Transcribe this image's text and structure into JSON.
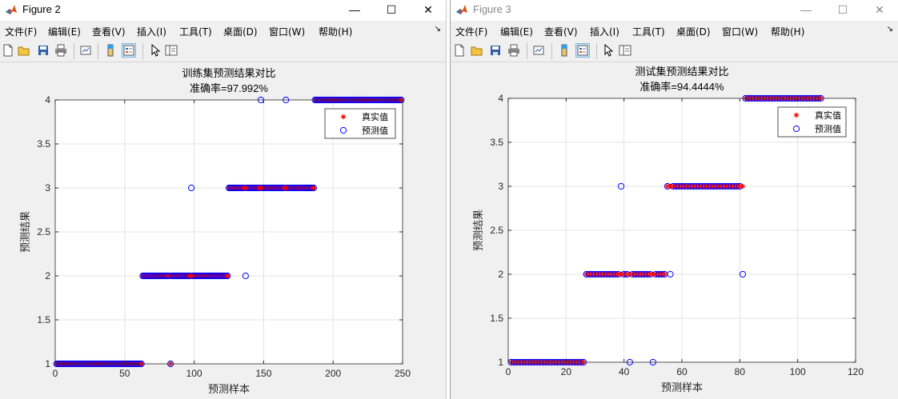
{
  "windows": [
    {
      "title": "Figure 2",
      "menus": [
        "文件(F)",
        "编辑(E)",
        "查看(V)",
        "插入(I)",
        "工具(T)",
        "桌面(D)",
        "窗口(W)",
        "帮助(H)"
      ],
      "controls": {
        "minimize": "—",
        "maximize": "☐",
        "close": "✕"
      }
    },
    {
      "title": "Figure 3",
      "menus": [
        "文件(F)",
        "编辑(E)",
        "查看(V)",
        "插入(I)",
        "工具(T)",
        "桌面(D)",
        "窗口(W)",
        "帮助(H)"
      ],
      "controls": {
        "minimize": "—",
        "maximize": "☐",
        "close": "✕"
      }
    }
  ],
  "toolbar_icons": [
    "new-figure-icon",
    "open-file-icon",
    "save-icon",
    "print-icon",
    "link-plot-icon",
    "colorbar-icon",
    "legend-icon",
    "pointer-icon",
    "plot-browser-icon"
  ],
  "chart_data": [
    {
      "type": "scatter",
      "title": "训练集预测结果对比",
      "subtitle": "准确率=97.992%",
      "xlabel": "预测样本",
      "ylabel": "预测结果",
      "xlim": [
        0,
        250
      ],
      "ylim": [
        1,
        4
      ],
      "xticks": [
        0,
        50,
        100,
        150,
        200,
        250
      ],
      "yticks": [
        1,
        1.5,
        2,
        2.5,
        3,
        3.5,
        4
      ],
      "xtick_labels": [
        "0",
        "50",
        "100",
        "150",
        "200",
        "250"
      ],
      "ytick_labels": [
        "1",
        "1.5",
        "2",
        "2.5",
        "3",
        "3.5",
        "4"
      ],
      "grid": true,
      "legend": {
        "position": "top-right",
        "entries": [
          "真实值",
          "预测值"
        ]
      },
      "colors": {
        "true": "#ff0000",
        "pred": "#0000ff"
      },
      "segments": [
        {
          "class": 1,
          "from": 1,
          "to": 62
        },
        {
          "class": 2,
          "from": 63,
          "to": 124
        },
        {
          "class": 3,
          "from": 125,
          "to": 186
        },
        {
          "class": 4,
          "from": 187,
          "to": 249
        }
      ],
      "mismatches": [
        {
          "x": 83,
          "true": 1,
          "pred": 1
        },
        {
          "x": 98,
          "true": 2,
          "pred": 3
        },
        {
          "x": 137,
          "true": 3,
          "pred": 2
        },
        {
          "x": 148,
          "true": 3,
          "pred": 4
        },
        {
          "x": 166,
          "true": 3,
          "pred": 4
        }
      ]
    },
    {
      "type": "scatter",
      "title": "测试集预测结果对比",
      "subtitle": "准确率=94.4444%",
      "xlabel": "预测样本",
      "ylabel": "预测结果",
      "xlim": [
        0,
        120
      ],
      "ylim": [
        1,
        4
      ],
      "xticks": [
        0,
        20,
        40,
        60,
        80,
        100,
        120
      ],
      "yticks": [
        1,
        1.5,
        2,
        2.5,
        3,
        3.5,
        4
      ],
      "xtick_labels": [
        "0",
        "20",
        "40",
        "60",
        "80",
        "100",
        "120"
      ],
      "ytick_labels": [
        "1",
        "1.5",
        "2",
        "2.5",
        "3",
        "3.5",
        "4"
      ],
      "grid": true,
      "legend": {
        "position": "top-right",
        "entries": [
          "真实值",
          "预测值"
        ]
      },
      "colors": {
        "true": "#ff0000",
        "pred": "#0000ff"
      },
      "segments": [
        {
          "class": 1,
          "from": 1,
          "to": 26
        },
        {
          "class": 2,
          "from": 27,
          "to": 54
        },
        {
          "class": 3,
          "from": 55,
          "to": 81
        },
        {
          "class": 4,
          "from": 82,
          "to": 108
        }
      ],
      "mismatches": [
        {
          "x": 39,
          "true": 2,
          "pred": 3
        },
        {
          "x": 42,
          "true": 2,
          "pred": 1
        },
        {
          "x": 50,
          "true": 2,
          "pred": 1
        },
        {
          "x": 56,
          "true": 3,
          "pred": 2
        },
        {
          "x": 81,
          "true": 3,
          "pred": 2
        }
      ]
    }
  ]
}
